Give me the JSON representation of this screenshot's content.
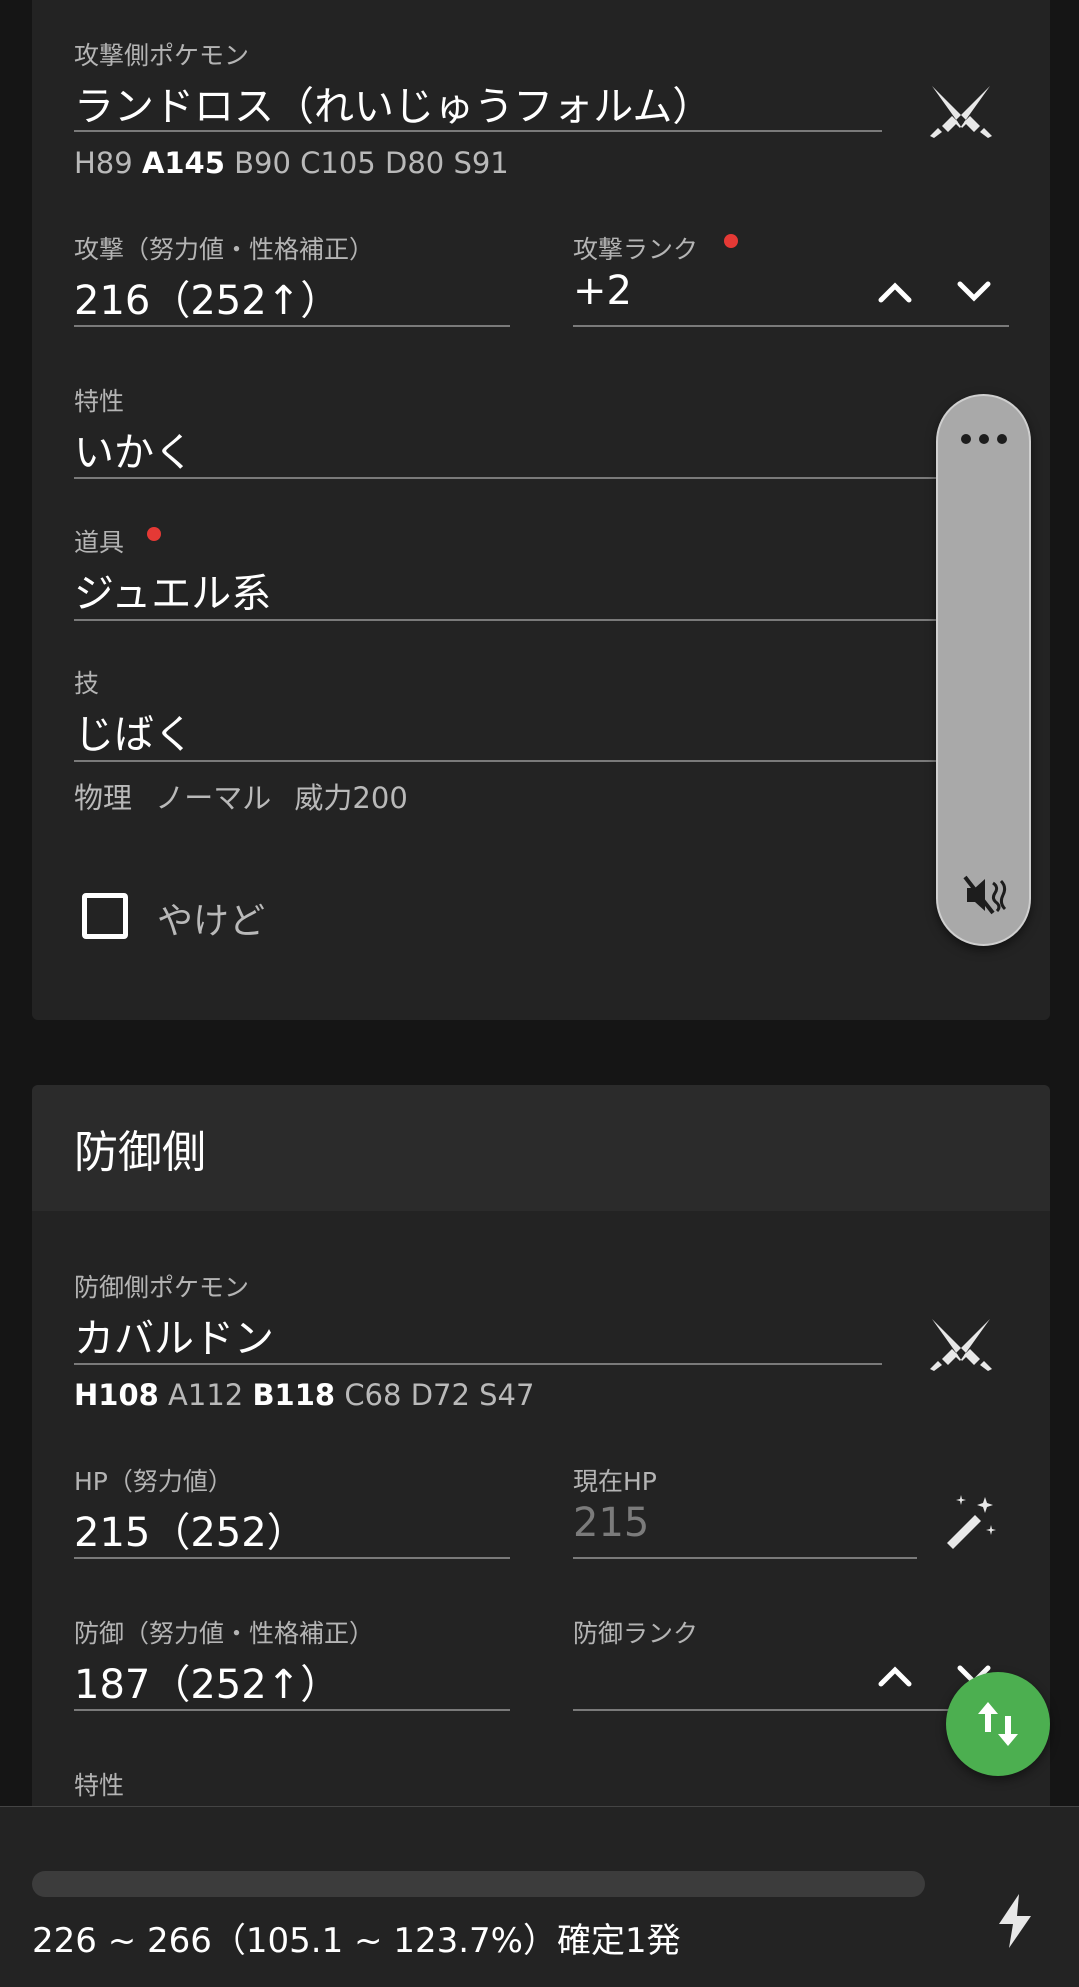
{
  "attacker": {
    "pokemon_label": "攻撃側ポケモン",
    "pokemon_name": "ランドロス（れいじゅうフォルム）",
    "stats": [
      {
        "text": "H89",
        "bold": false
      },
      {
        "text": "A145",
        "bold": true
      },
      {
        "text": "B90",
        "bold": false
      },
      {
        "text": "C105",
        "bold": false
      },
      {
        "text": "D80",
        "bold": false
      },
      {
        "text": "S91",
        "bold": false
      }
    ],
    "attack_label": "攻撃（努力値・性格補正）",
    "attack_value": "216（252↑）",
    "rank_label": "攻撃ランク",
    "rank_value": "+2",
    "ability_label": "特性",
    "ability_value": "いかく",
    "item_label": "道具",
    "item_value": "ジュエル系",
    "move_label": "技",
    "move_value": "じばく",
    "move_info": "物理 ノーマル 威力200",
    "burn_label": "やけど",
    "burn_checked": false
  },
  "defender": {
    "section_title": "防御側",
    "pokemon_label": "防御側ポケモン",
    "pokemon_name": "カバルドン",
    "stats": [
      {
        "text": "H108",
        "bold": true
      },
      {
        "text": "A112",
        "bold": false
      },
      {
        "text": "B118",
        "bold": true
      },
      {
        "text": "C68",
        "bold": false
      },
      {
        "text": "D72",
        "bold": false
      },
      {
        "text": "S47",
        "bold": false
      }
    ],
    "hp_label": "HP（努力値）",
    "hp_value": "215（252）",
    "current_hp_label": "現在HP",
    "current_hp_value": "215",
    "defense_label": "防御（努力値・性格補正）",
    "defense_value": "187（252↑）",
    "rank_label": "防御ランク",
    "rank_value": "",
    "ability_label": "特性"
  },
  "result": {
    "text": "226 ~ 266（105.1 ~ 123.7%）確定1発",
    "progress": 1.0
  },
  "colors": {
    "accent_dot": "#e53935",
    "fab": "#4caf50",
    "card": "#232323",
    "background": "#151515"
  },
  "icons": {
    "pokemon_picker": "crossed-swords-icon",
    "rank_up": "chevron-up-icon",
    "rank_down": "chevron-down-icon",
    "hp_reset": "magic-wand-icon",
    "panel_more": "more-horiz-icon",
    "panel_sound": "volume-off-icon",
    "swap": "swap-vertical-icon",
    "calc": "flash-icon"
  }
}
